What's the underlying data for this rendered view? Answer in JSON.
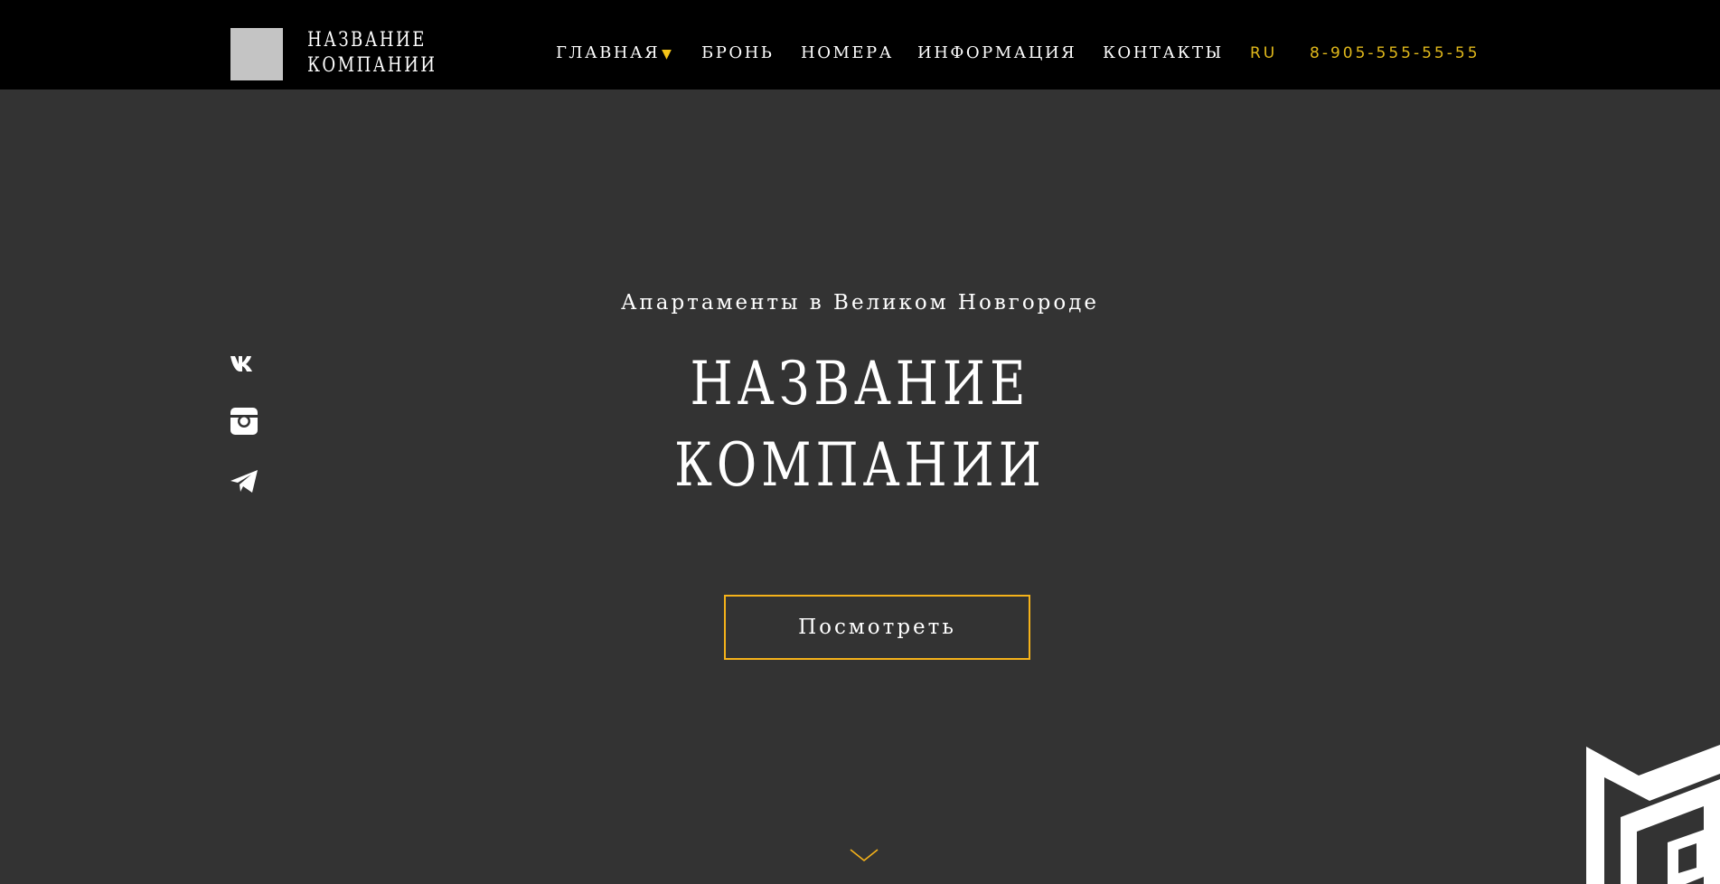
{
  "header": {
    "logo": {
      "line1": "НАЗВАНИЕ",
      "line2": "КОМПАНИИ"
    },
    "nav": [
      {
        "label": "ГЛАВНАЯ",
        "has_dropdown": true
      },
      {
        "label": "БРОНЬ"
      },
      {
        "label": "НОМЕРА"
      },
      {
        "label": "ИНФОРМАЦИЯ"
      },
      {
        "label": "КОНТАКТЫ"
      }
    ],
    "language": "RU",
    "phone": "8-905-555-55-55"
  },
  "social": [
    {
      "icon": "vk-icon"
    },
    {
      "icon": "instagram-icon"
    },
    {
      "icon": "telegram-icon"
    }
  ],
  "hero": {
    "subtitle": "Апартаменты в Великом Новгороде",
    "title_line1": "НАЗВАНИЕ",
    "title_line2": "КОМПАНИИ",
    "cta_label": "Посмотреть"
  },
  "colors": {
    "accent": "#f5c518",
    "accent_gold": "#e0b81b",
    "header_bg": "#000000",
    "page_bg": "#333333",
    "logo_placeholder": "#c4c4c4"
  }
}
